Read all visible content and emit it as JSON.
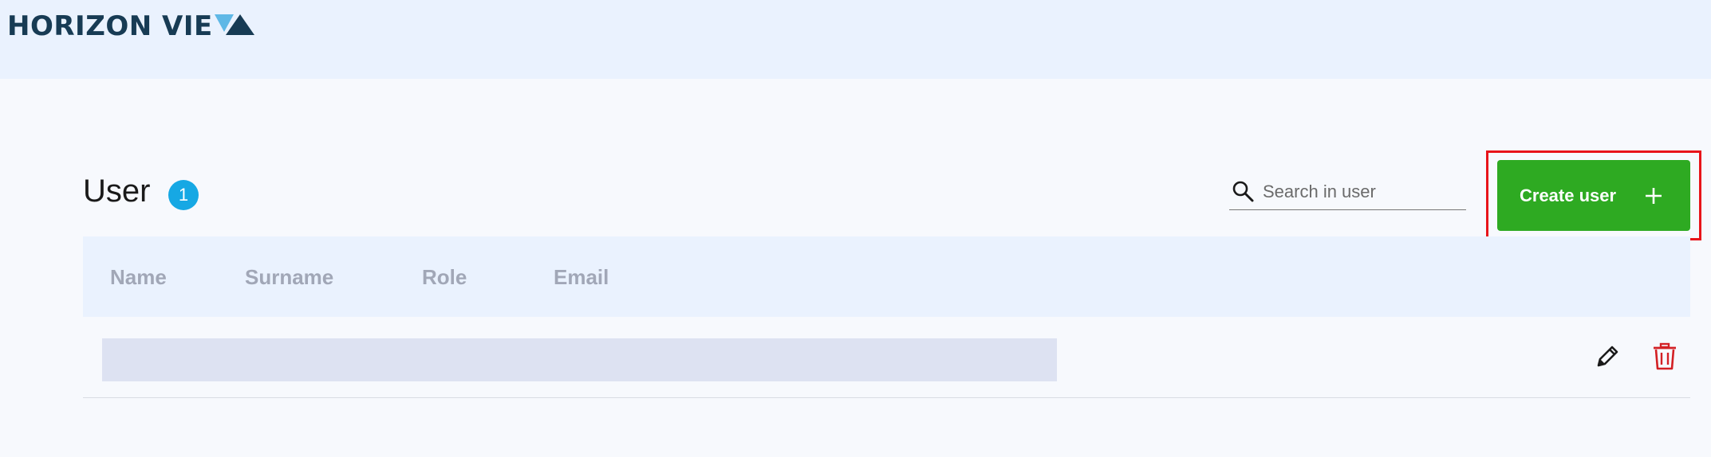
{
  "header": {
    "logo_text": "HORIZON VIE",
    "logo_icon": "triangle-logo-icon",
    "colors": {
      "logo_navy": "#173b54",
      "logo_light_blue": "#5fb8e6",
      "bar_background": "#eaf2fe"
    }
  },
  "users": {
    "title": "User",
    "count": "1",
    "search": {
      "placeholder": "Search in user",
      "value": "",
      "icon": "search-icon"
    },
    "create_button": {
      "label": "Create user",
      "icon": "plus-icon",
      "color": "#2eaa22",
      "highlight_color": "#e8141a"
    },
    "table": {
      "columns": [
        "Name",
        "Surname",
        "Role",
        "Email"
      ],
      "rows": [
        {
          "loading": true,
          "actions": [
            {
              "icon": "pencil-edit-icon",
              "color": "#1a1a1a"
            },
            {
              "icon": "trash-delete-icon",
              "color": "#d32024"
            }
          ]
        }
      ]
    }
  }
}
